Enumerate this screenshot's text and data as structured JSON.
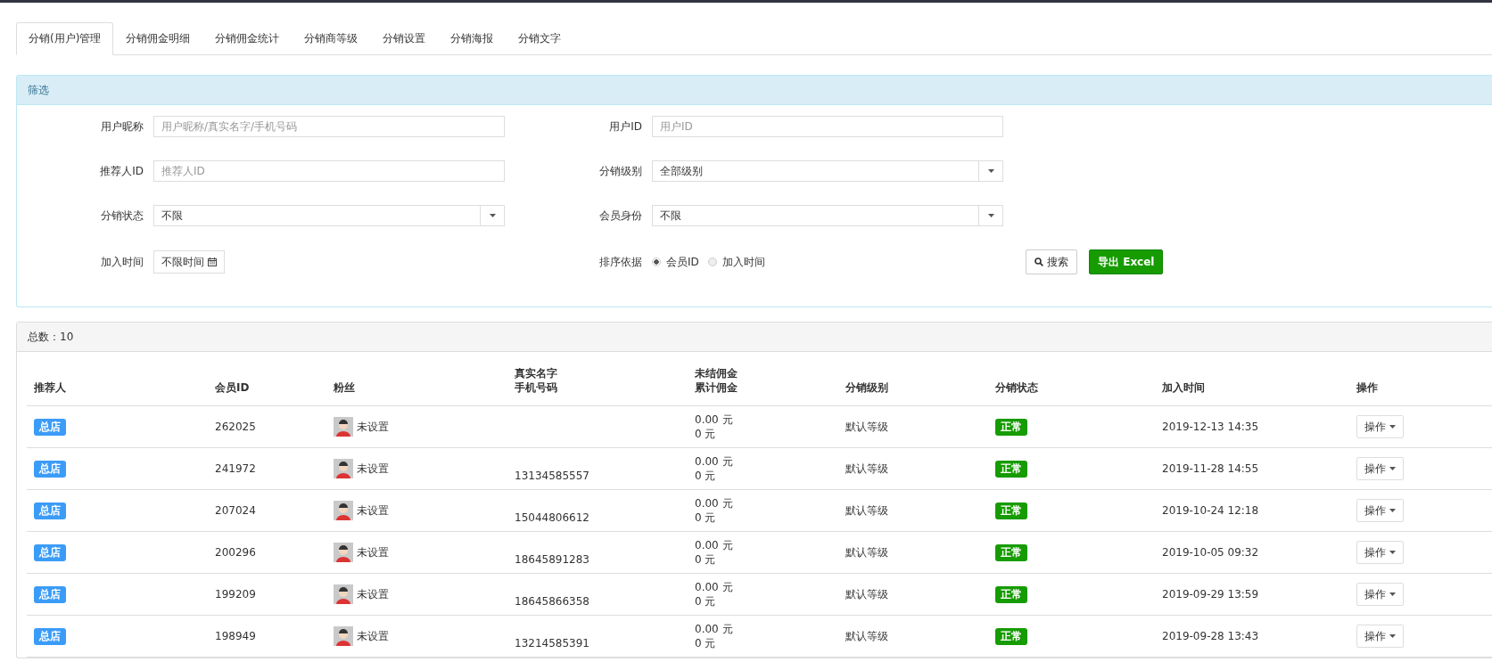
{
  "tabs": [
    {
      "label": "分销(用户)管理",
      "selected": true
    },
    {
      "label": "分销佣金明细",
      "selected": false
    },
    {
      "label": "分销佣金统计",
      "selected": false
    },
    {
      "label": "分销商等级",
      "selected": false
    },
    {
      "label": "分销设置",
      "selected": false
    },
    {
      "label": "分销海报",
      "selected": false
    },
    {
      "label": "分销文字",
      "selected": false
    }
  ],
  "filter": {
    "title": "筛选",
    "fields": [
      {
        "kind": "text",
        "label": "用户昵称",
        "placeholder": "用户昵称/真实名字/手机号码"
      },
      {
        "kind": "text",
        "label": "用户ID",
        "placeholder": "用户ID"
      },
      {
        "kind": "text",
        "label": "推荐人ID",
        "placeholder": "推荐人ID"
      },
      {
        "kind": "select",
        "label": "分销级别",
        "value": "全部级别"
      },
      {
        "kind": "select",
        "label": "分销状态",
        "value": "不限"
      },
      {
        "kind": "select",
        "label": "会员身份",
        "value": "不限"
      },
      {
        "kind": "date",
        "label": "加入时间",
        "value": "不限时间"
      },
      {
        "kind": "radio",
        "label": "排序依据",
        "options": [
          {
            "label": "会员ID",
            "selected": true
          },
          {
            "label": "加入时间",
            "selected": false
          }
        ]
      }
    ],
    "search_button": "搜索",
    "export_button": "导出 Excel"
  },
  "table": {
    "total": "总数：10",
    "columns": [
      [
        "推荐人"
      ],
      [
        "会员ID"
      ],
      [
        "粉丝"
      ],
      [
        "真实名字",
        "手机号码"
      ],
      [
        "未结佣金",
        "累计佣金"
      ],
      [
        "分销级别"
      ],
      [
        "分销状态"
      ],
      [
        "加入时间"
      ],
      [
        "操作"
      ]
    ],
    "rows": [
      {
        "referrer": "总店",
        "member_id": "262025",
        "fan": "未设置",
        "phone": "",
        "unsettled": "0.00 元",
        "total": "0 元",
        "level": "默认等级",
        "status": "正常",
        "joined": "2019-12-13 14:35",
        "action": "操作"
      },
      {
        "referrer": "总店",
        "member_id": "241972",
        "fan": "未设置",
        "phone": "13134585557",
        "unsettled": "0.00 元",
        "total": "0 元",
        "level": "默认等级",
        "status": "正常",
        "joined": "2019-11-28 14:55",
        "action": "操作"
      },
      {
        "referrer": "总店",
        "member_id": "207024",
        "fan": "未设置",
        "phone": "15044806612",
        "unsettled": "0.00 元",
        "total": "0 元",
        "level": "默认等级",
        "status": "正常",
        "joined": "2019-10-24 12:18",
        "action": "操作"
      },
      {
        "referrer": "总店",
        "member_id": "200296",
        "fan": "未设置",
        "phone": "18645891283",
        "unsettled": "0.00 元",
        "total": "0 元",
        "level": "默认等级",
        "status": "正常",
        "joined": "2019-10-05 09:32",
        "action": "操作"
      },
      {
        "referrer": "总店",
        "member_id": "199209",
        "fan": "未设置",
        "phone": "18645866358",
        "unsettled": "0.00 元",
        "total": "0 元",
        "level": "默认等级",
        "status": "正常",
        "joined": "2019-09-29 13:59",
        "action": "操作"
      },
      {
        "referrer": "总店",
        "member_id": "198949",
        "fan": "未设置",
        "phone": "13214585391",
        "unsettled": "0.00 元",
        "total": "0 元",
        "level": "默认等级",
        "status": "正常",
        "joined": "2019-09-28 13:43",
        "action": "操作"
      }
    ]
  }
}
